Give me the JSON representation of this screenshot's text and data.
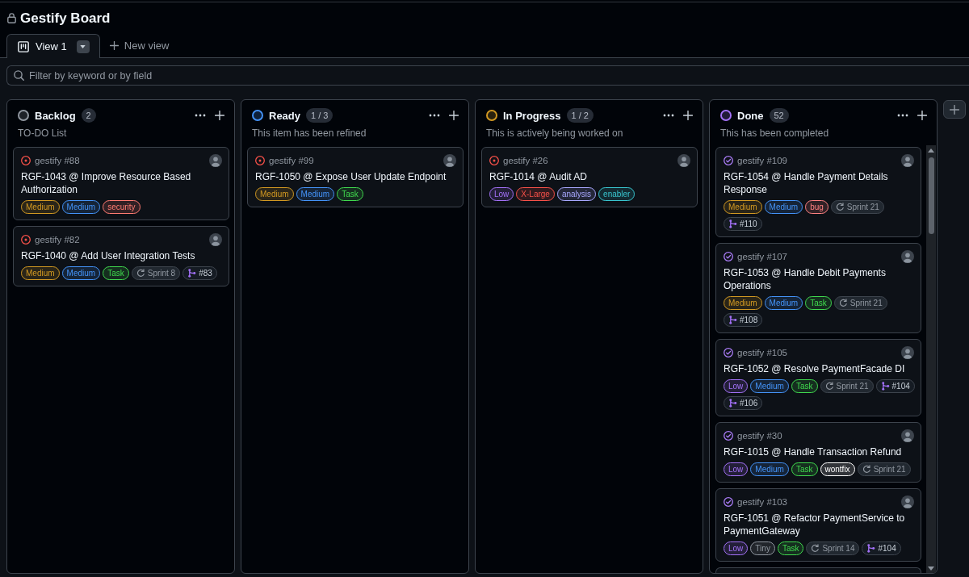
{
  "board": {
    "title": "Gestify Board",
    "locked": true
  },
  "view_tabs": [
    {
      "label": "View 1",
      "selected": true
    }
  ],
  "new_view": "New view",
  "filter": {
    "placeholder": "Filter by keyword or by field"
  },
  "columns": [
    {
      "name": "Backlog",
      "color": "#9198a1",
      "count": "2",
      "description": "TO-DO List",
      "more_cards": false,
      "cards": [
        {
          "reference": "gestify #88",
          "closed": false,
          "title": "RGF-1043 @ Improve Resource Based Authorization",
          "labels": [
            {
              "kind": "label",
              "text": "Medium",
              "color": "#d29922"
            },
            {
              "kind": "label",
              "text": "Medium",
              "color": "#4493f8"
            },
            {
              "kind": "label",
              "text": "security",
              "color": "#ff7b72"
            }
          ]
        },
        {
          "reference": "gestify #82",
          "closed": false,
          "title": "RGF-1040 @ Add User Integration Tests",
          "labels": [
            {
              "kind": "label",
              "text": "Medium",
              "color": "#d29922"
            },
            {
              "kind": "label",
              "text": "Medium",
              "color": "#4493f8"
            },
            {
              "kind": "label",
              "text": "Task",
              "color": "#40d94e"
            },
            {
              "kind": "iteration",
              "text": "Sprint 8"
            },
            {
              "kind": "pull_request",
              "text": "#83"
            }
          ]
        }
      ]
    },
    {
      "name": "Ready",
      "color": "#4493f8",
      "count": "1 / 3",
      "description": "This item has been refined",
      "more_cards": false,
      "cards": [
        {
          "reference": "gestify #99",
          "closed": false,
          "title": "RGF-1050 @ Expose User Update Endpoint",
          "labels": [
            {
              "kind": "label",
              "text": "Medium",
              "color": "#d29922"
            },
            {
              "kind": "label",
              "text": "Medium",
              "color": "#4493f8"
            },
            {
              "kind": "label",
              "text": "Task",
              "color": "#40d94e"
            }
          ]
        }
      ]
    },
    {
      "name": "In Progress",
      "color": "#d29922",
      "count": "1 / 2",
      "description": "This is actively being worked on",
      "more_cards": false,
      "cards": [
        {
          "reference": "gestify #26",
          "closed": false,
          "title": "RGF-1014 @ Audit AD",
          "labels": [
            {
              "kind": "label",
              "text": "Low",
              "color": "#a371f7"
            },
            {
              "kind": "label",
              "text": "X-Large",
              "color": "#f85149"
            },
            {
              "kind": "label",
              "text": "analysis",
              "color": "#a8a8ff"
            },
            {
              "kind": "label",
              "text": "enabler",
              "color": "#39c5cf"
            }
          ]
        }
      ]
    },
    {
      "name": "Done",
      "color": "#a371f7",
      "count": "52",
      "description": "This has been completed",
      "more_cards": true,
      "cards": [
        {
          "reference": "gestify #109",
          "closed": true,
          "title": "RGF-1054 @ Handle Payment Details Response",
          "labels": [
            {
              "kind": "label",
              "text": "Medium",
              "color": "#d29922"
            },
            {
              "kind": "label",
              "text": "Medium",
              "color": "#4493f8"
            },
            {
              "kind": "label",
              "text": "bug",
              "color": "#ff8182"
            },
            {
              "kind": "iteration",
              "text": "Sprint 21"
            },
            {
              "kind": "pull_request",
              "text": "#110"
            }
          ]
        },
        {
          "reference": "gestify #107",
          "closed": true,
          "title": "RGF-1053 @ Handle Debit Payments Operations",
          "labels": [
            {
              "kind": "label",
              "text": "Medium",
              "color": "#d29922"
            },
            {
              "kind": "label",
              "text": "Medium",
              "color": "#4493f8"
            },
            {
              "kind": "label",
              "text": "Task",
              "color": "#40d94e"
            },
            {
              "kind": "iteration",
              "text": "Sprint 21"
            },
            {
              "kind": "pull_request",
              "text": "#108"
            }
          ]
        },
        {
          "reference": "gestify #105",
          "closed": true,
          "title": "RGF-1052 @ Resolve PaymentFacade DI",
          "labels": [
            {
              "kind": "label",
              "text": "Low",
              "color": "#a371f7"
            },
            {
              "kind": "label",
              "text": "Medium",
              "color": "#4493f8"
            },
            {
              "kind": "label",
              "text": "Task",
              "color": "#40d94e"
            },
            {
              "kind": "iteration",
              "text": "Sprint 21"
            },
            {
              "kind": "pull_request",
              "text": "#104"
            },
            {
              "kind": "pull_request",
              "text": "#106"
            }
          ]
        },
        {
          "reference": "gestify #30",
          "closed": true,
          "title": "RGF-1015 @ Handle Transaction Refund",
          "labels": [
            {
              "kind": "label",
              "text": "Low",
              "color": "#a371f7"
            },
            {
              "kind": "label",
              "text": "Medium",
              "color": "#4493f8"
            },
            {
              "kind": "label",
              "text": "Task",
              "color": "#40d94e"
            },
            {
              "kind": "label",
              "text": "wontfix",
              "color": "#ffffff"
            },
            {
              "kind": "iteration",
              "text": "Sprint 21"
            }
          ]
        },
        {
          "reference": "gestify #103",
          "closed": true,
          "title": "RGF-1051 @ Refactor PaymentService to PaymentGateway",
          "labels": [
            {
              "kind": "label",
              "text": "Low",
              "color": "#a371f7"
            },
            {
              "kind": "label",
              "text": "Tiny",
              "color": "#9198a1"
            },
            {
              "kind": "label",
              "text": "Task",
              "color": "#40d94e"
            },
            {
              "kind": "iteration",
              "text": "Sprint 14"
            },
            {
              "kind": "pull_request",
              "text": "#104"
            }
          ]
        }
      ]
    }
  ]
}
